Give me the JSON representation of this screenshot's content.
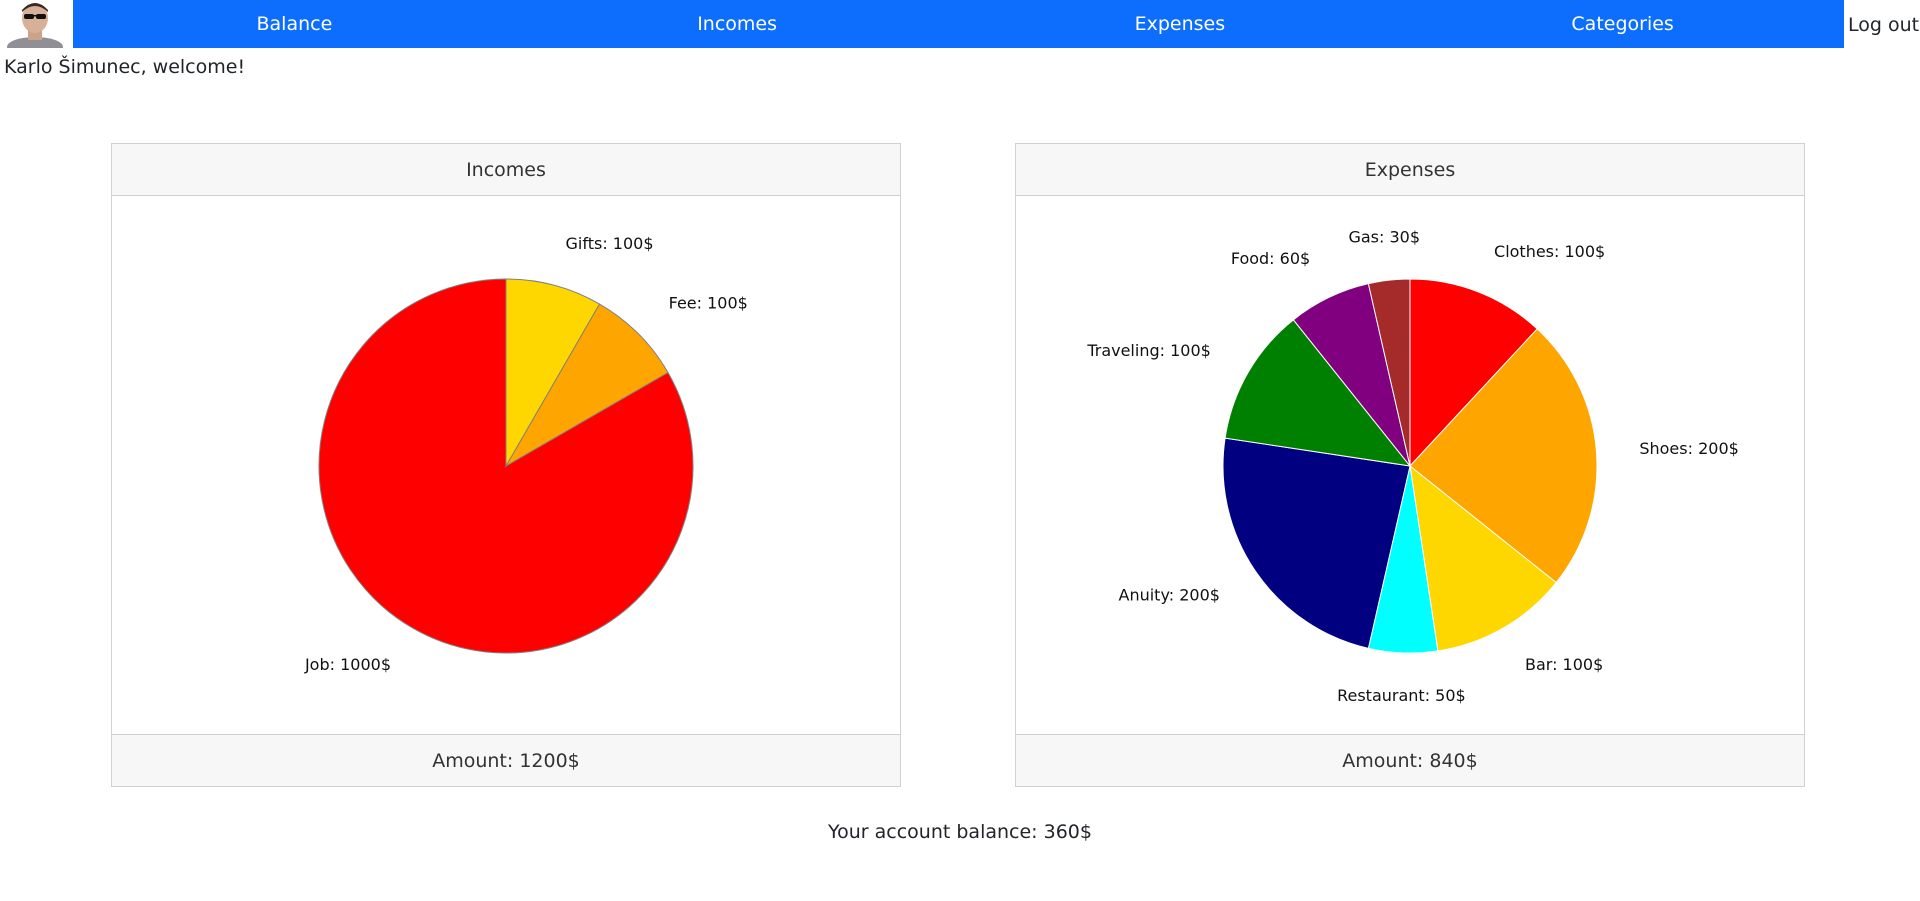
{
  "nav": {
    "items": [
      "Balance",
      "Incomes",
      "Expenses",
      "Categories"
    ],
    "logout_label": "Log out",
    "brand_color": "#0d6efd"
  },
  "welcome": "Karlo Šimunec, welcome!",
  "incomes": {
    "header": "Incomes",
    "footer": "Amount: 1200$"
  },
  "expenses": {
    "header": "Expenses",
    "footer": "Amount: 840$"
  },
  "balance_text": "Your account balance: 360$",
  "chart_data": [
    {
      "type": "pie",
      "title": "Incomes",
      "slices": [
        {
          "label": "Job: 1000$",
          "value": 1000,
          "color": "#ff0000"
        },
        {
          "label": "Fee: 100$",
          "value": 100,
          "color": "#ffa500"
        },
        {
          "label": "Gifts: 100$",
          "value": 100,
          "color": "#ffd700"
        }
      ],
      "stroke": "#808080",
      "direction": "counterclockwise-from-top"
    },
    {
      "type": "pie",
      "title": "Expenses",
      "slices": [
        {
          "label": "Clothes: 100$",
          "value": 100,
          "color": "#ff0000"
        },
        {
          "label": "Shoes: 200$",
          "value": 200,
          "color": "#ffa500"
        },
        {
          "label": "Bar: 100$",
          "value": 100,
          "color": "#ffd700"
        },
        {
          "label": "Restaurant: 50$",
          "value": 50,
          "color": "#00ffff"
        },
        {
          "label": "Anuity: 200$",
          "value": 200,
          "color": "#000080"
        },
        {
          "label": "Traveling: 100$",
          "value": 100,
          "color": "#008000"
        },
        {
          "label": "Food: 60$",
          "value": 60,
          "color": "#800080"
        },
        {
          "label": "Gas: 30$",
          "value": 30,
          "color": "#a52a2a"
        }
      ],
      "stroke": "#ffffff",
      "direction": "clockwise-from-top"
    }
  ]
}
